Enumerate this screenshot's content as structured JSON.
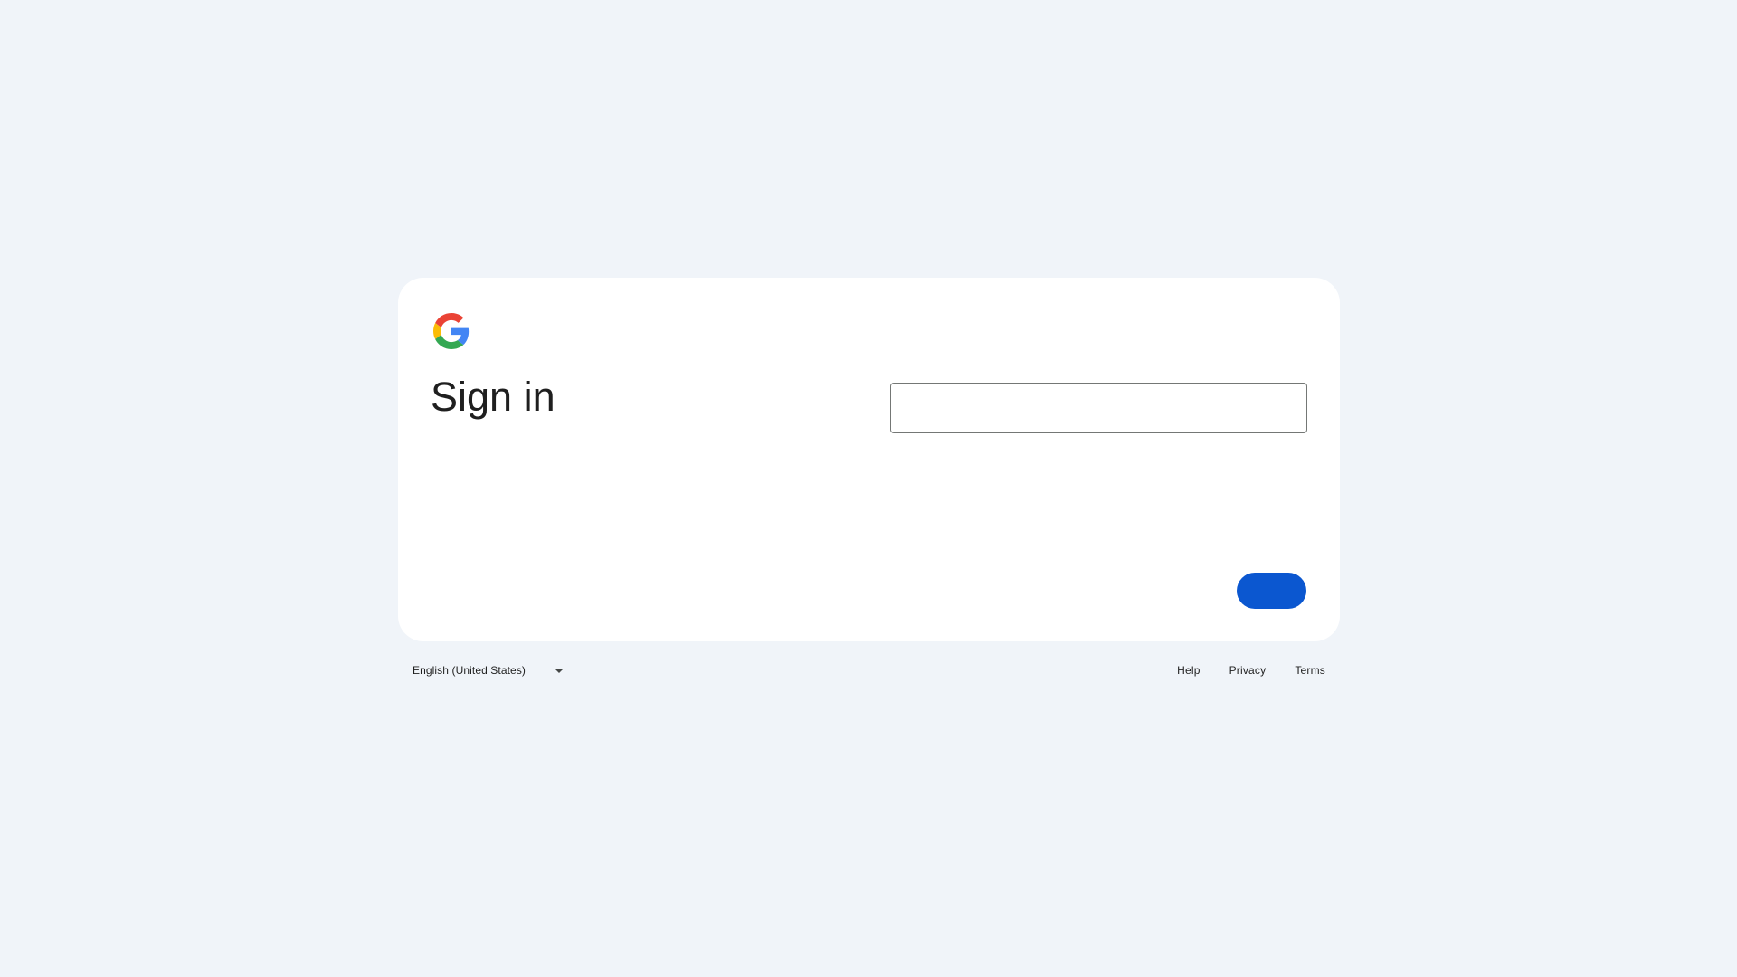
{
  "card": {
    "logo_icon": "google-g-icon",
    "title": "Sign in",
    "identifier_field": {
      "value": "",
      "placeholder": ""
    },
    "next_button_label": ""
  },
  "footer": {
    "language": "English (United States)",
    "language_icon": "caret-down-icon",
    "links": {
      "help": "Help",
      "privacy": "Privacy",
      "terms": "Terms"
    }
  },
  "colors": {
    "background": "#f0f4f9",
    "card": "#ffffff",
    "primary_button": "#0b57d0",
    "text": "#1f1f1f",
    "field_border": "#747775"
  }
}
